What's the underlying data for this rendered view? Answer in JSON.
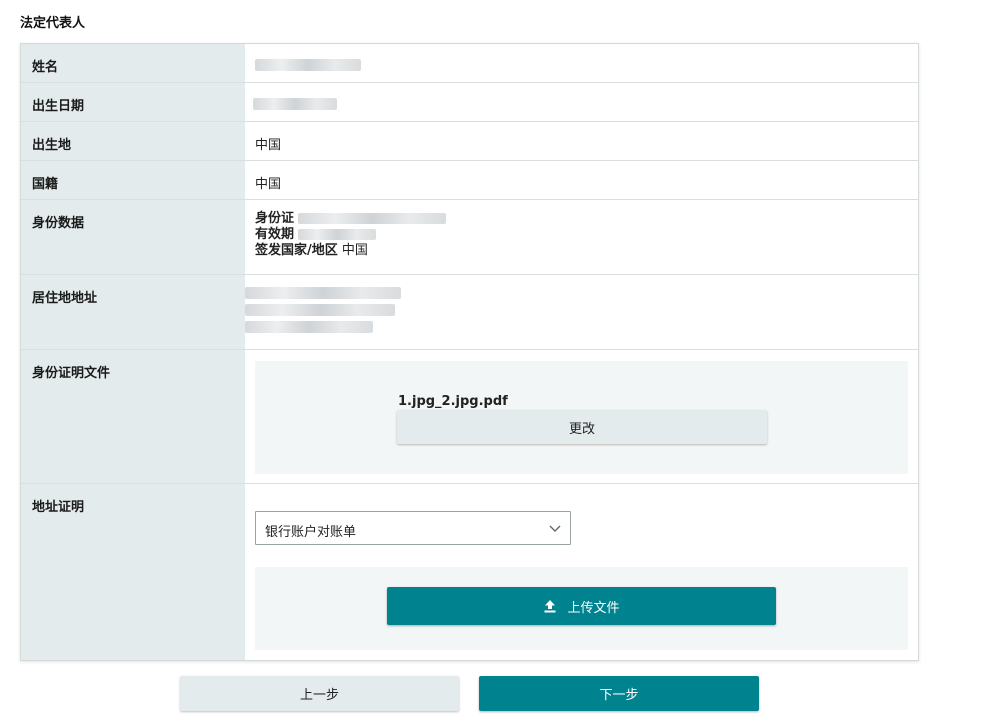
{
  "section": {
    "title": "法定代表人"
  },
  "rows": {
    "name": {
      "label": "姓名",
      "value": ""
    },
    "birth_date": {
      "label": "出生日期",
      "value": ""
    },
    "birth_place": {
      "label": "出生地",
      "value": "中国"
    },
    "nationality": {
      "label": "国籍",
      "value": "中国"
    },
    "identity": {
      "label": "身份数据",
      "id_label": "身份证",
      "validity_label": "有效期",
      "issuer_label": "签发国家/地区",
      "issuer_value": "中国"
    },
    "residence": {
      "label": "居住地地址"
    },
    "id_document": {
      "label": "身份证明文件",
      "file_name": "1.jpg_2.jpg.pdf",
      "change_label": "更改"
    },
    "address_proof": {
      "label": "地址证明",
      "selected_option": "银行账户对账单",
      "upload_label": "上传文件"
    }
  },
  "footer": {
    "prev_label": "上一步",
    "next_label": "下一步"
  },
  "colors": {
    "accent": "#00838f",
    "label_bg": "#e3ebec",
    "panel_bg": "#f3f6f6"
  }
}
